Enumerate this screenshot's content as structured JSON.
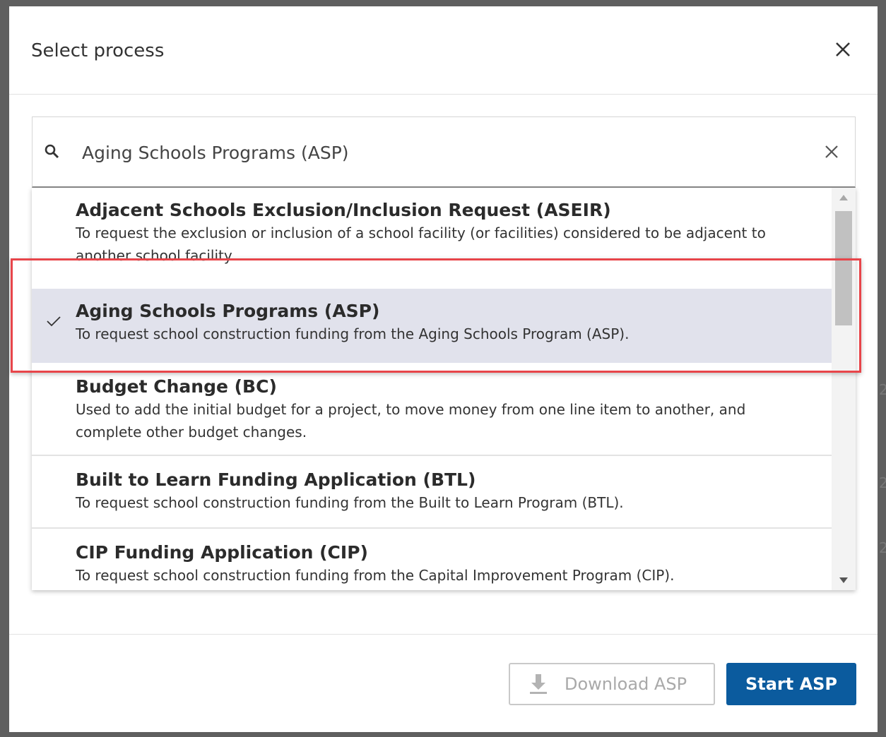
{
  "dialog": {
    "title": "Select process"
  },
  "search": {
    "value": "Aging Schools Programs (ASP)",
    "placeholder": ""
  },
  "options": [
    {
      "title": "Adjacent Schools Exclusion/Inclusion Request (ASEIR)",
      "description": "To request the exclusion or inclusion of a school facility (or facilities) considered to be adjacent to another school facility.",
      "selected": false
    },
    {
      "title": "Aging Schools Programs (ASP)",
      "description": "To request school construction funding from the Aging Schools Program (ASP).",
      "selected": true
    },
    {
      "title": "Budget Change (BC)",
      "description": "Used to add the initial budget for a project, to move money from one line item to another, and complete other budget changes.",
      "selected": false
    },
    {
      "title": "Built to Learn Funding Application (BTL)",
      "description": "To request school construction funding from the Built to Learn Program (BTL).",
      "selected": false
    },
    {
      "title": "CIP Funding Application (CIP)",
      "description": "To request school construction funding from the Capital Improvement Program (CIP).",
      "selected": false
    }
  ],
  "footer": {
    "download_label": "Download ASP",
    "start_label": "Start ASP"
  },
  "colors": {
    "primary_button": "#0b5b9e",
    "selected_row": "#e1e2ec",
    "highlight_annotation": "#e8454a"
  }
}
